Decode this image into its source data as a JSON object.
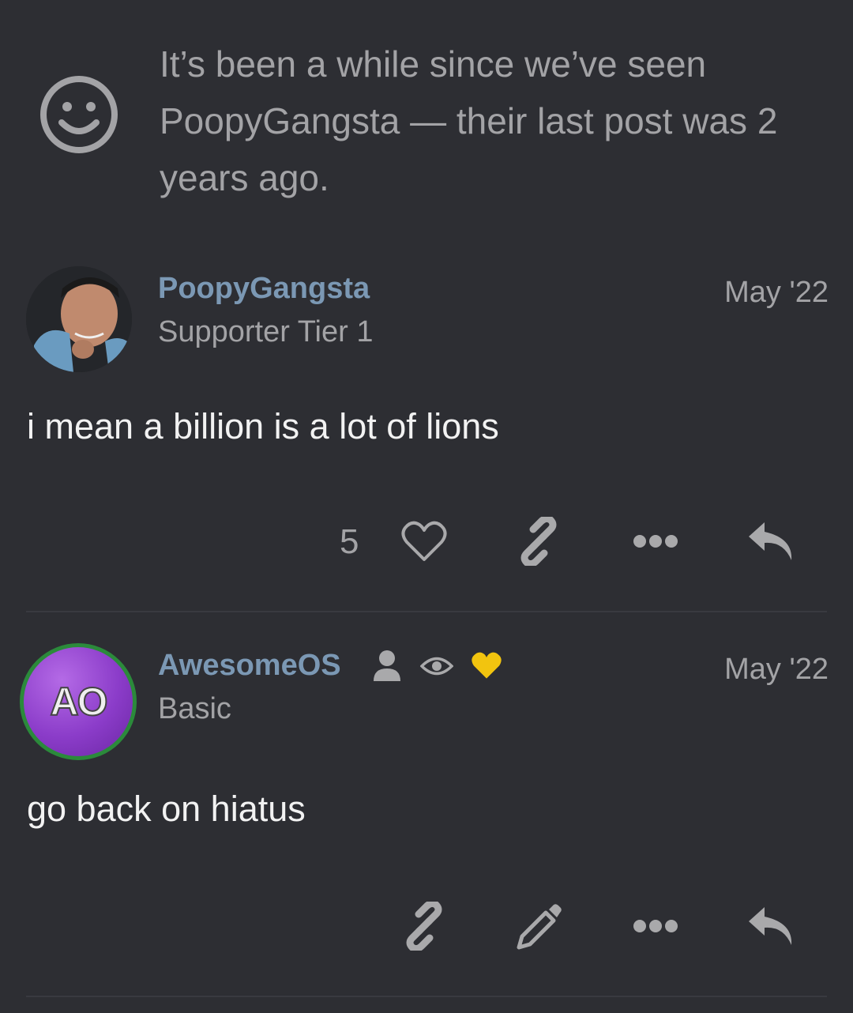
{
  "notice": {
    "text": "It’s been a while since we’ve seen PoopyGangsta — their last post was 2 years ago.",
    "icon": "smile-icon"
  },
  "posts": [
    {
      "username": "PoopyGangsta",
      "user_title": "Supporter Tier 1",
      "date": "May '22",
      "body": "i mean a billion is a lot of lions",
      "like_count": "5",
      "actions": [
        "heart-icon",
        "link-icon",
        "more-icon",
        "reply-icon"
      ]
    },
    {
      "username": "AwesomeOS",
      "avatar_letters": "AO",
      "user_title": "Basic",
      "date": "May '22",
      "body": "go back on hiatus",
      "badges": [
        "person-icon",
        "eye-icon",
        "heart-badge-icon"
      ],
      "actions": [
        "link-icon",
        "edit-icon",
        "more-icon",
        "reply-icon"
      ]
    }
  ],
  "colors": {
    "background": "#2d2e33",
    "username": "#7b98b4",
    "muted": "#a3a3a6",
    "body_text": "#f2f2f2",
    "ao_ring": "#2b8a3b",
    "heart_badge": "#f2c40f"
  }
}
